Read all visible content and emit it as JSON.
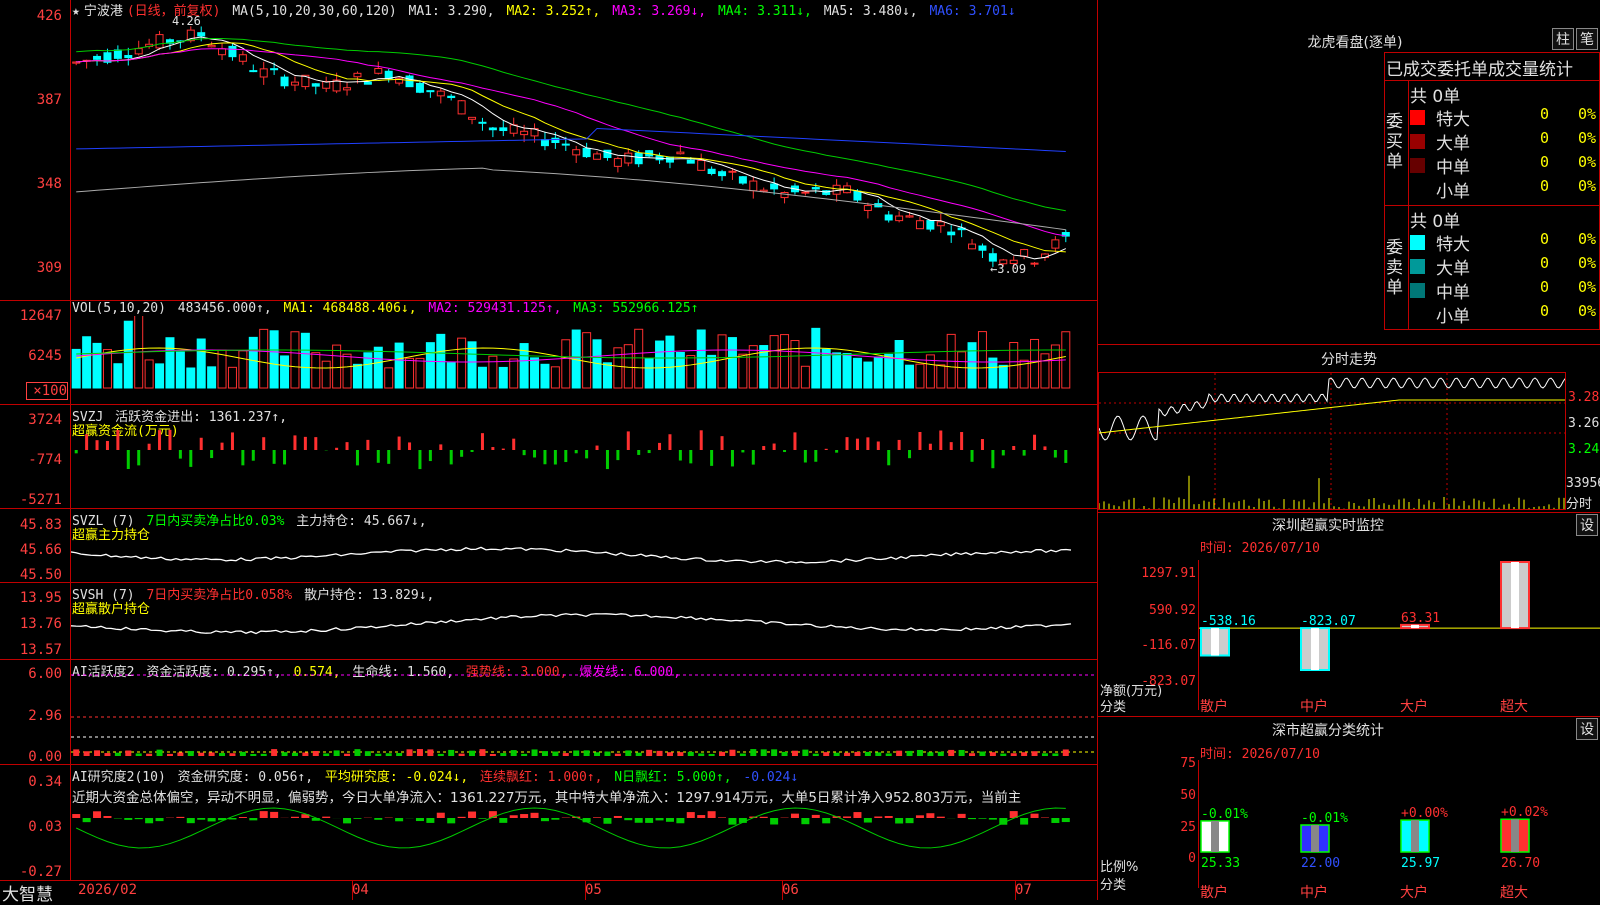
{
  "stock": {
    "star": "★",
    "name": "宁波港",
    "mode": "(日线，前复权)"
  },
  "main_header": {
    "ma_params": "MA(5,10,20,30,60,120)",
    "ma1": "MA1: 3.290,",
    "ma2": "MA2: 3.252↑,",
    "ma3": "MA3: 3.269↓,",
    "ma4": "MA4: 3.311↓,",
    "ma5": "MA5: 3.480↓,",
    "ma6": "MA6: 3.701↓"
  },
  "price_axis": [
    "426",
    "387",
    "348",
    "309"
  ],
  "annotations": {
    "high": "4.26",
    "low": "←3.09"
  },
  "vol_header": {
    "label": "VOL(5,10,20)",
    "value": "483456.000↑,",
    "ma1": "MA1: 468488.406↓,",
    "ma2": "MA2: 529431.125↑,",
    "ma3": "MA3: 552966.125↑"
  },
  "vol_axis": [
    "12647",
    "6245",
    "×100"
  ],
  "svzj": {
    "line1_label": "SVZJ",
    "line1_text": "活跃资金进出: 1361.237↑,",
    "line2": "超赢资金流(万元)",
    "axis": [
      "3724",
      "-774",
      "-5271"
    ]
  },
  "svzl": {
    "label": "SVZL (7)",
    "ratio": "7日内买卖净占比0.03%",
    "hold": "主力持仓: 45.667↓,",
    "line2": "超赢主力持仓",
    "axis": [
      "45.83",
      "45.66",
      "45.50"
    ]
  },
  "svsh": {
    "label": "SVSH (7)",
    "ratio": "7日内买卖净占比0.058%",
    "hold": "散户持仓: 13.829↓,",
    "line2": "超赢散户持仓",
    "axis": [
      "13.95",
      "13.76",
      "13.57"
    ]
  },
  "ai_active": {
    "label": "AI活跃度2",
    "act": "资金活跃度: 0.295↑,",
    "v2": "0.574,",
    "life": "生命线: 1.560,",
    "strong": "强势线: 3.000,",
    "burst": "爆发线: 6.000,",
    "axis": [
      "6.00",
      "2.96",
      "0.00"
    ]
  },
  "ai_research": {
    "label": "AI研究度2(10)",
    "res": "资金研究度: 0.056↑,",
    "avg": "平均研究度: -0.024↓,",
    "cont": "连续飘红: 1.000↑,",
    "nday": "N日飘红: 5.000↑,",
    "last": "-0.024↓",
    "summary": "近期大资金总体偏空，异动不明显，偏弱势，今日大单净流入：1361.227万元，其中特大单净流入：1297.914万元，大单5日累计净入952.803万元，当前主",
    "axis": [
      "0.34",
      "0.03",
      "-0.27"
    ]
  },
  "xaxis": {
    "brand": "大智慧",
    "labels": [
      "2026/02",
      "04",
      "05",
      "06",
      "07"
    ]
  },
  "lhb": {
    "title": "龙虎看盘(逐单)",
    "btn1": "柱",
    "btn2": "笔",
    "subtitle": "已成交委托单成交量统计",
    "buy": {
      "side": "委买单",
      "total": "共 0单",
      "rows": [
        {
          "label": "特大",
          "count": "0",
          "pct": "0%",
          "color": "#ff0000"
        },
        {
          "label": "大单",
          "count": "0",
          "pct": "0%",
          "color": "#990000"
        },
        {
          "label": "中单",
          "count": "0",
          "pct": "0%",
          "color": "#660000"
        },
        {
          "label": "小单",
          "count": "0",
          "pct": "0%",
          "color": "#000000"
        }
      ]
    },
    "sell": {
      "side": "委卖单",
      "total": "共 0单",
      "rows": [
        {
          "label": "特大",
          "count": "0",
          "pct": "0%",
          "color": "#00ffff"
        },
        {
          "label": "大单",
          "count": "0",
          "pct": "0%",
          "color": "#009999"
        },
        {
          "label": "中单",
          "count": "0",
          "pct": "0%",
          "color": "#007777"
        },
        {
          "label": "小单",
          "count": "0",
          "pct": "0%",
          "color": "#000000"
        }
      ]
    }
  },
  "intraday": {
    "title": "分时走势",
    "axis": [
      "3.280",
      "3.260",
      "3.240"
    ],
    "vol_label": "33956",
    "vol_unit": "分时"
  },
  "monitor": {
    "title": "深圳超赢实时监控",
    "btn": "设",
    "time": "时间: 2026/07/10",
    "axis": [
      "1297.91",
      "590.92",
      "-116.07",
      "-823.07"
    ],
    "ylabel1": "净额(万元)",
    "ylabel2": "分类"
  },
  "classify": {
    "title": "深市超赢分类统计",
    "btn": "设",
    "time": "时间: 2026/07/10",
    "axis": [
      "75",
      "50",
      "25",
      "0"
    ],
    "ylabel1": "比例%",
    "ylabel2": "分类"
  },
  "chart_data": [
    {
      "type": "bar",
      "title": "深圳超赢实时监控",
      "categories": [
        "散户",
        "中户",
        "大户",
        "超大"
      ],
      "values": [
        -538.16,
        -823.07,
        63.31,
        1297.91
      ],
      "ylabel": "净额(万元)",
      "xlabel": "分类",
      "ylim": [
        -823.07,
        1297.91
      ]
    },
    {
      "type": "bar",
      "title": "深市超赢分类统计",
      "categories": [
        "散户",
        "中户",
        "大户",
        "超大"
      ],
      "series": [
        {
          "name": "change",
          "labels": [
            "-0.01%",
            "-0.01%",
            "+0.00%",
            "+0.02%"
          ]
        }
      ],
      "values": [
        25.33,
        22.0,
        25.97,
        26.7
      ],
      "ylabel": "比例%",
      "xlabel": "分类",
      "ylim": [
        0,
        75
      ],
      "colors": [
        "#ffffff",
        "#3030ff",
        "#00ffff",
        "#ff3030"
      ]
    }
  ]
}
